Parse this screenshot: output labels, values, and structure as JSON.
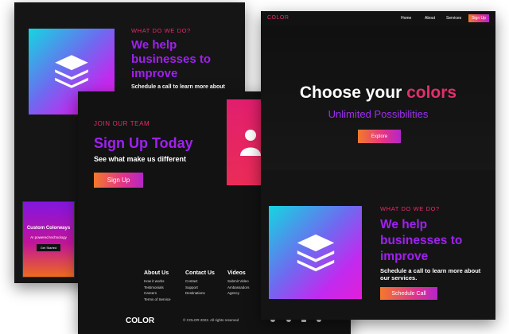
{
  "back_left": {
    "eyebrow": "WHAT DO WE DO?",
    "headline": "We help businesses to improve",
    "sub": "Schedule a call to learn more about",
    "card": {
      "title": "Custom Colorways",
      "subtitle": "AI powered technology",
      "button": "Get Started"
    }
  },
  "front_mid": {
    "eyebrow": "JOIN OUR TEAM",
    "headline": "Sign Up Today",
    "sub": "See what make us different",
    "button": "Sign Up",
    "footer": {
      "about": {
        "heading": "About Us",
        "items": [
          "How it works",
          "Testimonials",
          "Careers",
          "Terms of Service"
        ]
      },
      "contact": {
        "heading": "Contact Us",
        "items": [
          "Contact",
          "Support",
          "Destinations"
        ]
      },
      "videos": {
        "heading": "Videos",
        "items": [
          "Submit Video",
          "Ambassadors",
          "Agency"
        ]
      },
      "logo": "COLOR",
      "copyright": "© COLOR 2022. All rights reserved"
    }
  },
  "right_panel": {
    "nav": {
      "logo": "COLOR",
      "home": "Home",
      "about": "About",
      "services": "Services",
      "signup": "Sign Up"
    },
    "hero": {
      "title_a": "Choose your ",
      "title_b": "colors",
      "subtitle": "Unlimited Possibilities",
      "button": "Explore"
    },
    "section": {
      "eyebrow": "WHAT DO WE DO?",
      "headline": "We help businesses to improve",
      "sub": "Schedule a call to learn more about our services.",
      "button": "Schedule Call"
    }
  },
  "colors": {
    "pink": "#e0306a",
    "purple": "#a020f0",
    "dark_bg": "#151515"
  },
  "icons": [
    "layers-icon",
    "user-icon",
    "facebook-icon",
    "instagram-icon",
    "youtube-icon",
    "twitter-icon"
  ]
}
